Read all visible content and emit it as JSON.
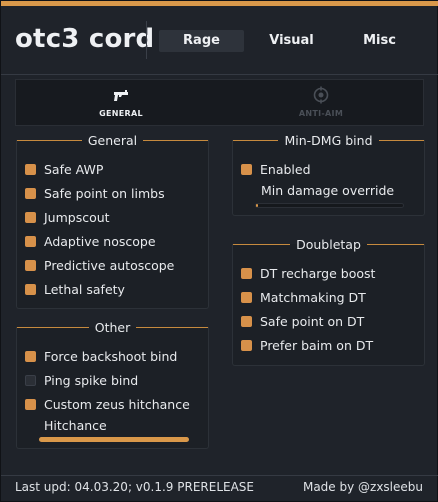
{
  "app": {
    "title": "otc3 cord",
    "accent": "#d9984a"
  },
  "tabs": [
    {
      "label": "Rage",
      "active": true
    },
    {
      "label": "Visual",
      "active": false
    },
    {
      "label": "Misc",
      "active": false
    }
  ],
  "subtabs": [
    {
      "label": "GENERAL",
      "icon": "gun-icon",
      "active": true
    },
    {
      "label": "ANTI-AIM",
      "icon": "crosshair-icon",
      "active": false
    }
  ],
  "groups": {
    "general": {
      "title": "General",
      "options": [
        {
          "label": "Safe AWP",
          "checked": true
        },
        {
          "label": "Safe point on limbs",
          "checked": true
        },
        {
          "label": "Jumpscout",
          "checked": true
        },
        {
          "label": "Adaptive noscope",
          "checked": true
        },
        {
          "label": "Predictive autoscope",
          "checked": true
        },
        {
          "label": "Lethal safety",
          "checked": true
        }
      ]
    },
    "other": {
      "title": "Other",
      "options": [
        {
          "label": "Force backshoot bind",
          "checked": true
        },
        {
          "label": "Ping spike bind",
          "checked": false
        },
        {
          "label": "Custom zeus hitchance",
          "checked": true
        }
      ],
      "slider": {
        "label": "Hitchance",
        "fraction": 1.0
      }
    },
    "mindmg": {
      "title": "Min-DMG bind",
      "options": [
        {
          "label": "Enabled",
          "checked": true
        }
      ],
      "slider": {
        "label": "Min damage override",
        "fraction": 0.0
      }
    },
    "doubletap": {
      "title": "Doubletap",
      "options": [
        {
          "label": "DT recharge boost",
          "checked": true
        },
        {
          "label": "Matchmaking DT",
          "checked": true
        },
        {
          "label": "Safe point on DT",
          "checked": true
        },
        {
          "label": "Prefer baim on DT",
          "checked": true
        }
      ]
    }
  },
  "footer": {
    "left": "Last upd: 04.03.20; v0.1.9 PRERELEASE",
    "right": "Made by @zxsleebu"
  }
}
